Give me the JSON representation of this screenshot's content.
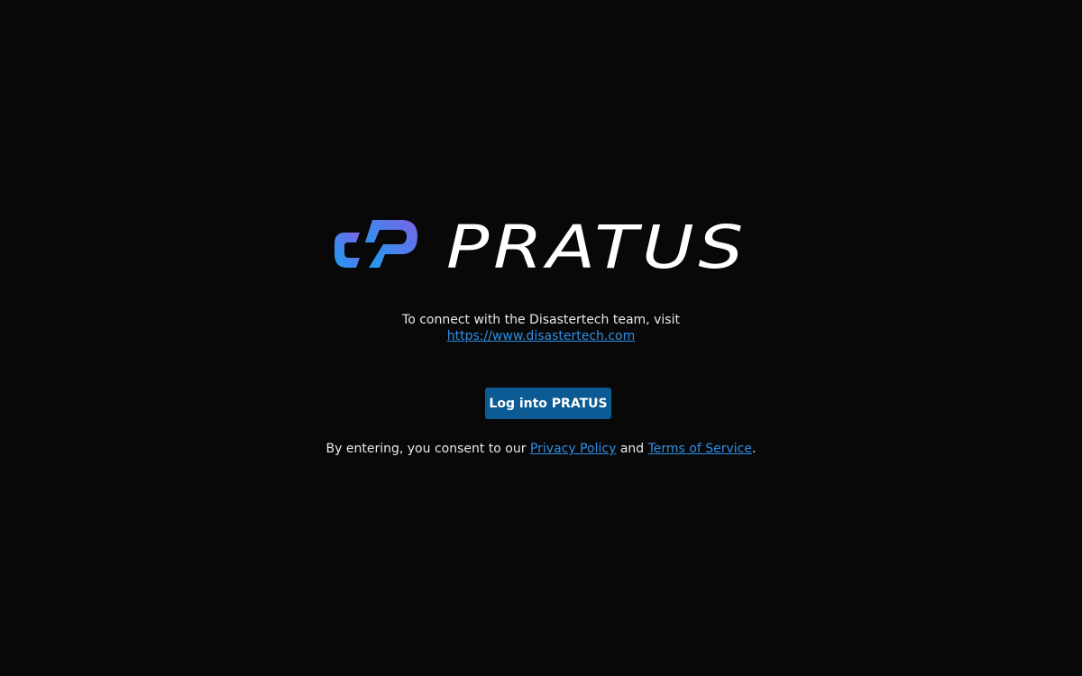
{
  "brand": {
    "name": "PRATUS",
    "gradient_start": "#1aa0f0",
    "gradient_end": "#7a63e8"
  },
  "connect": {
    "text": "To connect with the Disastertech team, visit",
    "link_text": "https://www.disastertech.com"
  },
  "login_button": {
    "label": "Log into PRATUS",
    "color": "#0b5a94"
  },
  "consent": {
    "prefix": "By entering, you consent to our ",
    "privacy_link": "Privacy Policy",
    "middle": " and ",
    "terms_link": "Terms of Service",
    "suffix": "."
  },
  "colors": {
    "background": "#080808",
    "link": "#2f8fe6",
    "text": "#e8e8e8"
  }
}
